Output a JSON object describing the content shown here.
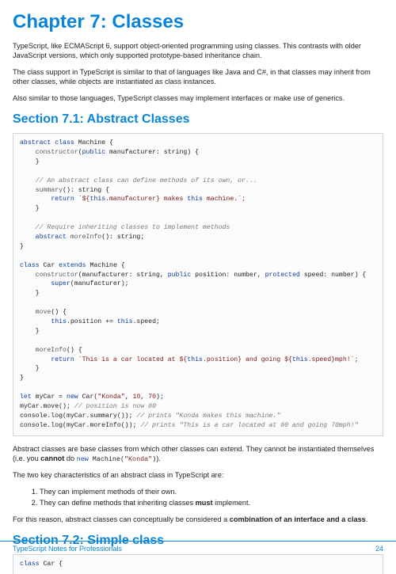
{
  "chapter_title": "Chapter 7: Classes",
  "intro": [
    "TypeScript, like ECMAScript 6, support object-oriented programming using classes. This contrasts with older JavaScript versions, which only supported prototype-based inheritance chain.",
    "The class support in TypeScript is similar to that of languages like Java and C#, in that classes may inherit from other classes, while objects are instantiated as class instances.",
    "Also similar to those languages, TypeScript classes may implement interfaces or make use of generics."
  ],
  "section1_title": "Section 7.1: Abstract Classes",
  "code1": {
    "l1_kw1": "abstract",
    "l1_kw2": "class",
    "l1_cls": "Machine",
    "l1_brace": " {",
    "l2_fn": "constructor",
    "l2_p": "(",
    "l2_kw": "public",
    "l2_param": " manufacturer: string) {",
    "l3": "    }",
    "l5_cm": "    // An abstract class can define methods of its own, or...",
    "l6_fn": "summary",
    "l6_rest": "(): string {",
    "l7_kw": "return",
    "l7_s1": " `${",
    "l7_kw2": "this",
    "l7_s2": ".manufacturer} makes ",
    "l7_kw3": "this",
    "l7_s3": " machine.`;",
    "l8": "    }",
    "l10_cm": "    // Require inheriting classes to implement methods",
    "l11_kw1": "abstract",
    "l11_fn": " moreInfo",
    "l11_rest": "(): string;",
    "l12": "}"
  },
  "code2": {
    "l1_kw": "class",
    "l1_cls": " Car ",
    "l1_kw2": "extends",
    "l1_base": " Machine {",
    "l2_fn": "constructor",
    "l2_p": "(manufacturer: string, ",
    "l2_kw1": "public",
    "l2_p2": " position: number, ",
    "l2_kw2": "protected",
    "l2_p3": " speed: number) {",
    "l3_kw": "super",
    "l3_rest": "(manufacturer);",
    "l4": "    }",
    "l6_fn": "move",
    "l6_rest": "() {",
    "l7_kw1": "this",
    "l7_mid": ".position += ",
    "l7_kw2": "this",
    "l7_end": ".speed;",
    "l8": "    }",
    "l10_fn": "moreInfo",
    "l10_rest": "() {",
    "l11_kw": "return",
    "l11_s1": " `This is a car located at ${",
    "l11_kw2": "this",
    "l11_s2": ".position} and going ${",
    "l11_kw3": "this",
    "l11_s3": ".speed}mph!`;",
    "l12": "    }",
    "l13": "}"
  },
  "code3": {
    "l1_kw": "let",
    "l1_var": " myCar = ",
    "l1_kw2": "new",
    "l1_cls": " Car(",
    "l1_str": "\"Konda\"",
    "l1_c": ", ",
    "l1_n1": "10",
    "l1_c2": ", ",
    "l1_n2": "70",
    "l1_end": ");",
    "l2_call": "myCar.move(); ",
    "l2_cm": "// position is now 80",
    "l3_call": "console.log(myCar.summary()); ",
    "l3_cm": "// prints \"Konda makes this machine.\"",
    "l4_call": "console.log(myCar.moreInfo()); ",
    "l4_cm": "// prints \"This is a car located at 80 and going 70mph!\""
  },
  "para_after1_a": "Abstract classes are base classes from which other classes can extend. They cannot be instantiated themselves (i.e. you ",
  "para_after1_b": "cannot",
  "para_after1_c": " do ",
  "para_after1_code_kw": "new",
  "para_after1_code_mid": " Machine(",
  "para_after1_code_str": "\"Konda\"",
  "para_after1_code_end": ")",
  "para_after1_d": ").",
  "para_after2": "The two key characteristics of an abstract class in TypeScript are:",
  "list": [
    "They can implement methods of their own.",
    "They can define methods that inheriting classes "
  ],
  "list2_bold": "must",
  "list2_tail": " implement.",
  "para_after3_a": "For this reason, abstract classes can conceptually be considered a ",
  "para_after3_b": "combination of an interface and a class",
  "para_after3_c": ".",
  "section2_title": "Section 7.2: Simple class",
  "code4_kw": "class",
  "code4_rest": " Car {",
  "footer_left": "TypeScript Notes for Professionals",
  "footer_right": "24"
}
